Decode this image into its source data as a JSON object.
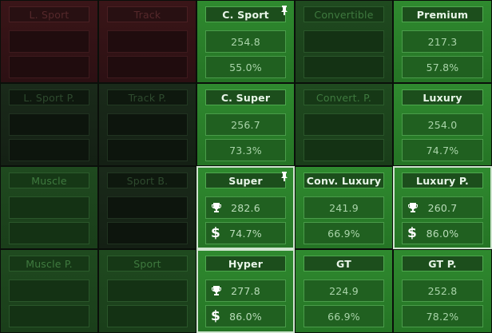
{
  "cells": [
    {
      "title": "L. Sport",
      "top": "",
      "bottom": "",
      "icons": []
    },
    {
      "title": "Track",
      "top": "",
      "bottom": "",
      "icons": []
    },
    {
      "title": "C. Sport",
      "top": "254.8",
      "bottom": "55.0%",
      "pinned": true
    },
    {
      "title": "Convertible",
      "top": "",
      "bottom": ""
    },
    {
      "title": "Premium",
      "top": "217.3",
      "bottom": "57.8%"
    },
    {
      "title": "L. Sport P.",
      "top": "",
      "bottom": ""
    },
    {
      "title": "Track P.",
      "top": "",
      "bottom": ""
    },
    {
      "title": "C. Super",
      "top": "256.7",
      "bottom": "73.3%"
    },
    {
      "title": "Convert. P.",
      "top": "",
      "bottom": ""
    },
    {
      "title": "Luxury",
      "top": "254.0",
      "bottom": "74.7%"
    },
    {
      "title": "Muscle",
      "top": "",
      "bottom": ""
    },
    {
      "title": "Sport B.",
      "top": "",
      "bottom": ""
    },
    {
      "title": "Super",
      "top": "282.6",
      "bottom": "74.7%",
      "pinned": true,
      "trophy": true,
      "dollar": true
    },
    {
      "title": "Conv. Luxury",
      "top": "241.9",
      "bottom": "66.9%"
    },
    {
      "title": "Luxury P.",
      "top": "260.7",
      "bottom": "86.0%",
      "trophy": true,
      "dollar": true
    },
    {
      "title": "Muscle P.",
      "top": "",
      "bottom": ""
    },
    {
      "title": "Sport",
      "top": "",
      "bottom": ""
    },
    {
      "title": "Hyper",
      "top": "277.8",
      "bottom": "86.0%",
      "trophy": true,
      "dollar": true
    },
    {
      "title": "GT",
      "top": "224.9",
      "bottom": "66.9%"
    },
    {
      "title": "GT P.",
      "top": "252.8",
      "bottom": "78.2%"
    }
  ],
  "icons": {
    "trophy": "trophy-icon",
    "dollar": "dollar-icon",
    "pin": "pin-icon"
  }
}
